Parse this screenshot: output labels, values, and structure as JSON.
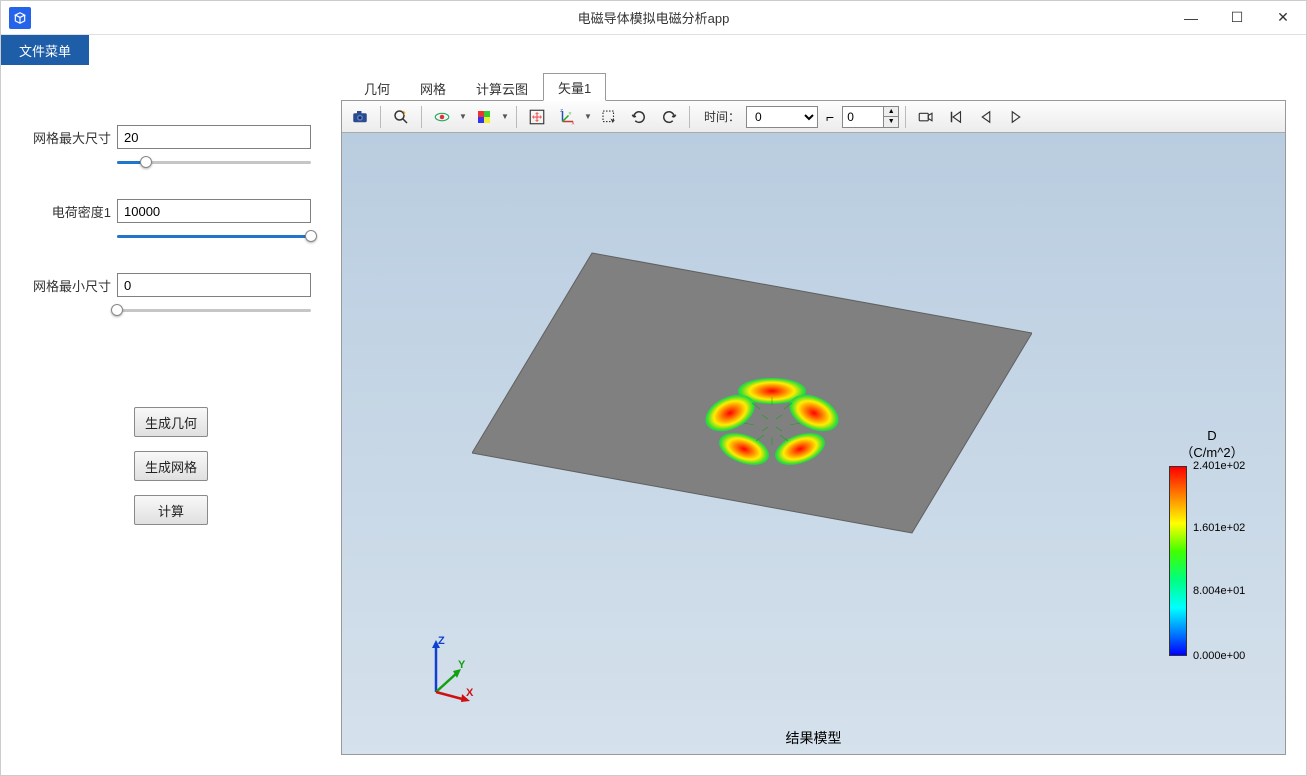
{
  "window": {
    "title": "电磁导体模拟电磁分析app"
  },
  "menu": {
    "file": "文件菜单"
  },
  "sidebar": {
    "params": [
      {
        "label": "网格最大尺寸",
        "value": "20",
        "slider_pct": 15
      },
      {
        "label": "电荷密度1",
        "value": "10000",
        "slider_pct": 100
      },
      {
        "label": "网格最小尺寸",
        "value": "0",
        "slider_pct": 0
      }
    ],
    "buttons": {
      "gen_geom": "生成几何",
      "gen_mesh": "生成网格",
      "compute": "计算"
    }
  },
  "tabs": {
    "items": [
      "几何",
      "网格",
      "计算云图",
      "矢量1"
    ],
    "active_index": 3
  },
  "toolbar": {
    "time_label": "时间：",
    "time_value": "0",
    "spin_value": "0",
    "right_angle": "⌐"
  },
  "viewer": {
    "caption": "结果模型",
    "axes": {
      "x": "X",
      "y": "Y",
      "z": "Z"
    },
    "colorbar": {
      "title_line1": "D",
      "title_line2": "（C/m^2）",
      "ticks": [
        {
          "label": "2.401e+02",
          "pos": 0
        },
        {
          "label": "1.601e+02",
          "pos": 33
        },
        {
          "label": "8.004e+01",
          "pos": 66
        },
        {
          "label": "0.000e+00",
          "pos": 100
        }
      ]
    }
  },
  "chart_data": {
    "type": "heatmap",
    "title": "D（C/m^2）",
    "field_variable": "D",
    "units": "C/m^2",
    "colormap_range": [
      0.0,
      240.1
    ],
    "ticks": [
      0.0,
      80.04,
      160.1,
      240.1
    ],
    "colormap": "rainbow",
    "description": "Electric displacement field magnitude on conductor surface, isometric 3D view"
  }
}
